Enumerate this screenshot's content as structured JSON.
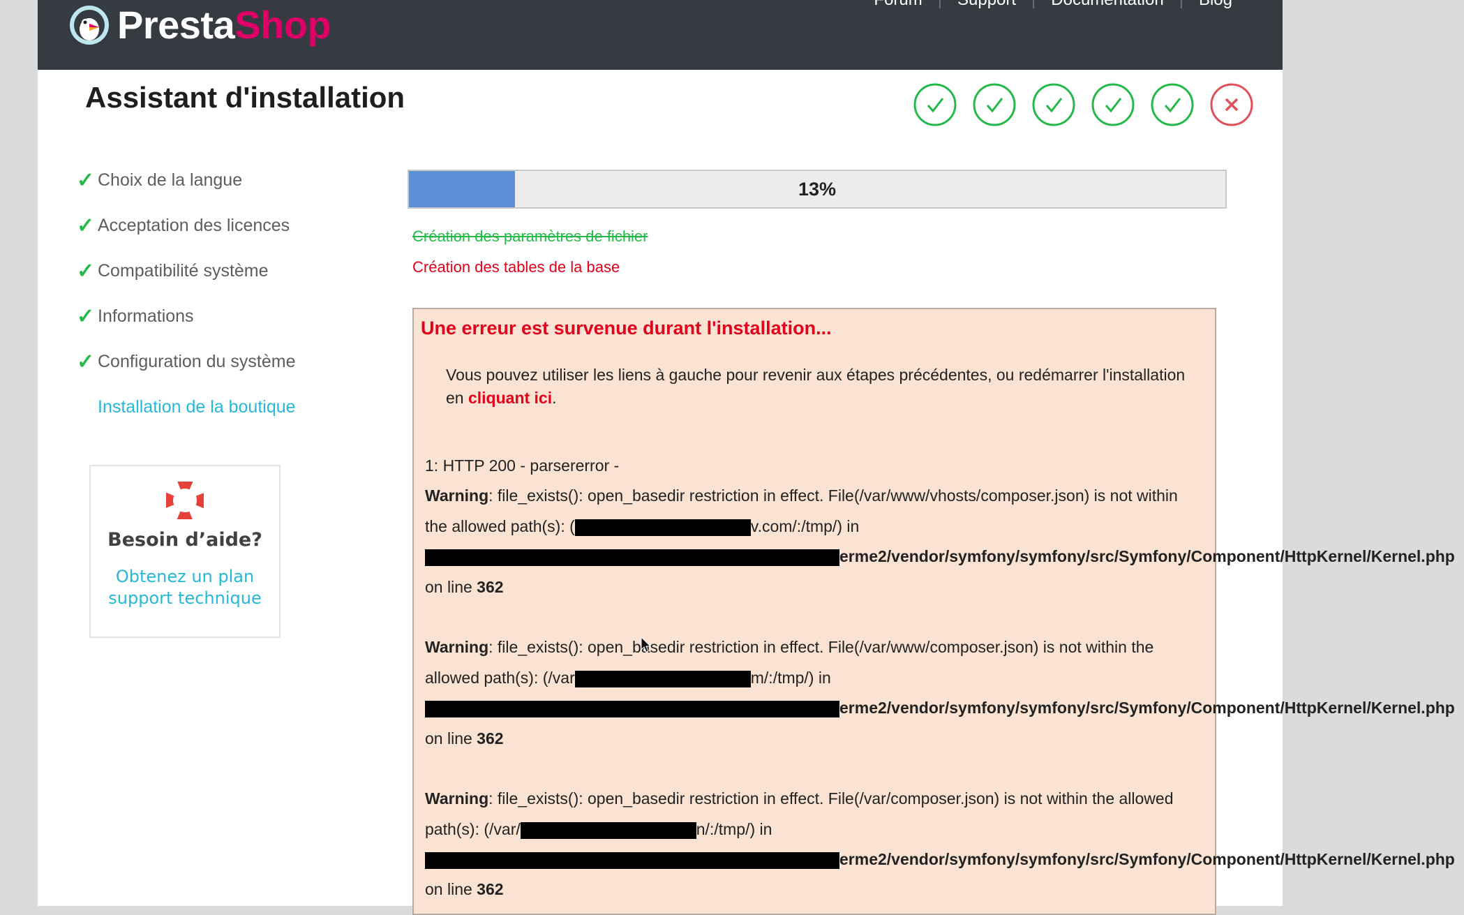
{
  "header": {
    "brand_part1": "Presta",
    "brand_part2": "Shop",
    "nav": [
      "Forum",
      "Support",
      "Documentation",
      "Blog"
    ]
  },
  "page_title": "Assistant d'installation",
  "step_icons": [
    "check",
    "check",
    "check",
    "check",
    "check",
    "error"
  ],
  "sidebar": {
    "items": [
      {
        "label": "Choix de la langue",
        "done": true
      },
      {
        "label": "Acceptation des licences",
        "done": true
      },
      {
        "label": "Compatibilité système",
        "done": true
      },
      {
        "label": "Informations",
        "done": true
      },
      {
        "label": "Configuration du système",
        "done": true
      },
      {
        "label": "Installation de la boutique",
        "done": false
      }
    ]
  },
  "help": {
    "title": "Besoin d’aide?",
    "link": "Obtenez un plan support technique"
  },
  "progress": {
    "percent": 13,
    "label": "13%"
  },
  "status": {
    "done": "Création des paramètres de fichier",
    "current": "Création des tables de la base"
  },
  "error": {
    "title": "Une erreur est survenue durant l'installation...",
    "desc_before": "Vous pouvez utiliser les liens à gauche pour revenir aux étapes précédentes, ou redémarrer l'installation en ",
    "desc_link": "cliquant ici",
    "desc_after": ".",
    "log_header": "1: HTTP 200 - parsererror -",
    "warning_label": "Warning",
    "warnings": [
      {
        "line1": ": file_exists(): open_basedir restriction in effect. File(/var/www/vhosts/composer.json) is not within",
        "line2_before": "the allowed path(s): (",
        "line2_after": "v.com/:/tmp/) in",
        "path": "erme2/vendor/symfony/symfony/src/Symfony/Component/HttpKernel/Kernel.php",
        "on_line": "on line",
        "line_no": "362"
      },
      {
        "line1": ": file_exists(): open_basedir restriction in effect. File(/var/www/composer.json) is not within the",
        "line2_before": "allowed path(s): (/var",
        "line2_after": "m/:/tmp/) in",
        "path": "erme2/vendor/symfony/symfony/src/Symfony/Component/HttpKernel/Kernel.php",
        "on_line": "on line",
        "line_no": "362"
      },
      {
        "line1": ": file_exists(): open_basedir restriction in effect. File(/var/composer.json) is not within the allowed",
        "line2_before": "path(s): (/var/",
        "line2_after": "n/:/tmp/) in",
        "path": "erme2/vendor/symfony/symfony/src/Symfony/Component/HttpKernel/Kernel.php",
        "on_line": "on line",
        "line_no": "362"
      }
    ]
  },
  "colors": {
    "topbar": "#363a41",
    "brand_pink": "#df0067",
    "success_green": "#25b94a",
    "error_red": "#e2001a",
    "link_cyan": "#25b9d7",
    "progress_fill": "#5c8fd6",
    "error_bg": "#fae3d2"
  }
}
